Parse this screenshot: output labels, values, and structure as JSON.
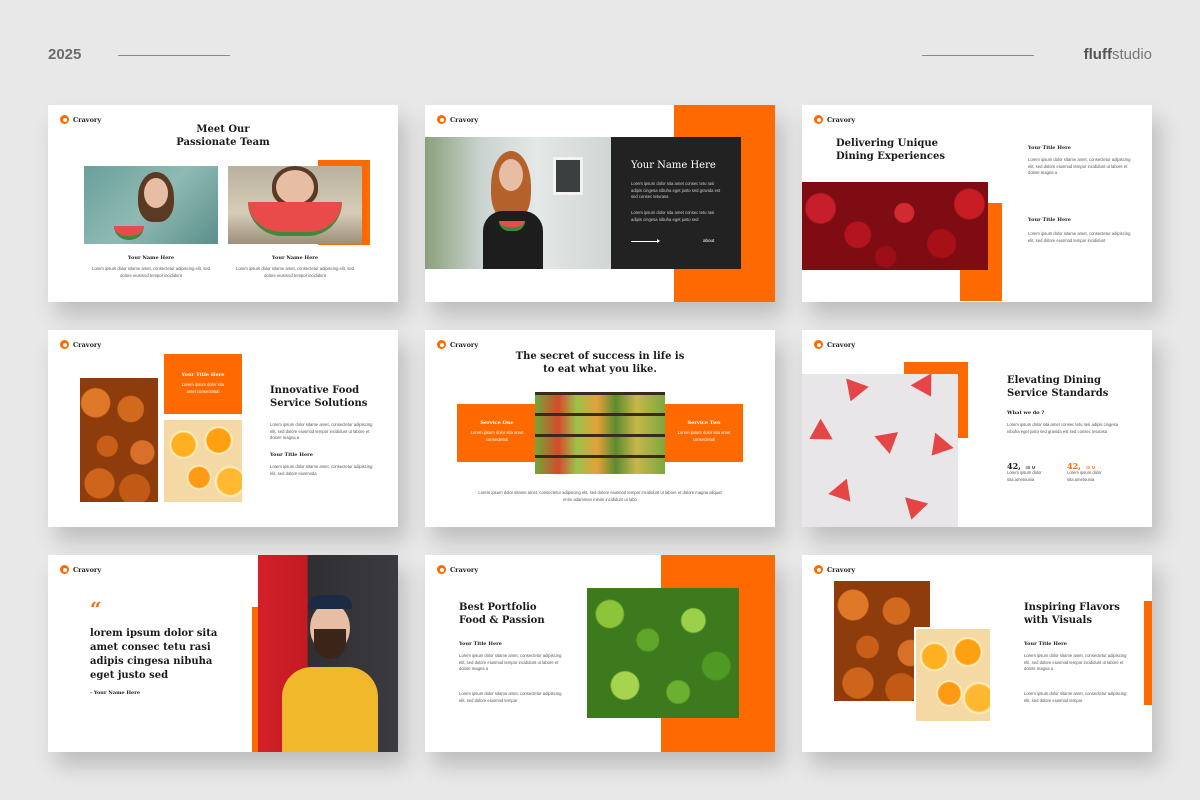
{
  "header": {
    "year": "2025",
    "brand_bold": "fluff",
    "brand_rest": "studio"
  },
  "logo_text": "Cravory",
  "colors": {
    "accent": "#ff6a00",
    "dark": "#222222",
    "background": "#e8e8e8"
  },
  "lorem_short": "Lorem ipsum dolor sitame amet, consectetur adipiscing elit, sed dolore eiusmod tempor incididunt",
  "s1": {
    "title_line1": "Meet Our",
    "title_line2": "Passionate Team",
    "card1_name": "Your Name Here",
    "card1_text": "Lorem ipsum dolor sitame amet, consectetur adipiscing elit, sed dolore eiusmod tempor incididunt",
    "card2_name": "Your Name Here",
    "card2_text": "Lorem ipsum dolor sitame amet, consectetur adipiscing elit, sed dolore eiusmod tempor incididunt"
  },
  "s2": {
    "title": "Your Name Here",
    "text1": "Lorem ipsum dolor sita amet consec tetu rasi adipis cingesa nibuha eget justo sed gravida est sed consec teturasa",
    "text2": "Lorem ipsum dolor sita amet consec tetu rasi adipis cingesa nibuha eget justo sed",
    "link": "about"
  },
  "s3": {
    "title_line1": "Delivering Unique",
    "title_line2": "Dining Experiences",
    "head1": "Your Title Here",
    "text1": "Lorem ipsum dolor sitame amet, consectetur adipiscing elit, sed dolore eiusmod tempor incididunt ut labore et dolore magna a",
    "head2": "Your Title Here",
    "text2": "Lorem ipsum dolor sitame amet, consectetur adipiscing elit, sed dolore eiusmod tempor incididunt"
  },
  "s4": {
    "box_head": "Your Title Here",
    "box_text": "Lorem ipsum dolor sita amet consectetuti",
    "title_line1": "Innovative Food",
    "title_line2": "Service Solutions",
    "text1": "Lorem ipsum dolor sitame amet, consectetur adipiscing elit, sed dolore eiusmod tempor incididunt ut labore et dolore magna a",
    "head2": "Your Title Here",
    "text2": "Lorem ipsum dolor sitame amet, consectetur adipiscing elit, sed dolore eiusmoda"
  },
  "s5": {
    "title_line1": "The secret of success in life is",
    "title_line2": "to eat what you like.",
    "left_head": "Service One",
    "left_text": "Lorem ipsum dolor sita amet consectetuti",
    "right_head": "Service Two",
    "right_text": "Lorem ipsum dolor sita amet consectetuti",
    "footer_text": "Lorem ipsum dolor sitame amet, consectetur adipiscing elit, sed dolore eiusmod tempor incididunt ut labore et dolore magna aliquat enim adamman minim incididunt ut labo"
  },
  "s6": {
    "title_line1": "Elevating Dining",
    "title_line2": "Service Standards",
    "subhead": "What we do ?",
    "text": "Lorem ipsum dolor sita amet consec tetu rasi adipis cingesa nibuha eget justo sed gravida est sed consec teturasa",
    "stat1_num": "42,",
    "stat1_unit": "45 M",
    "stat1_text": "Lorem ipsum dolor sita ametounia",
    "stat2_num": "42,",
    "stat2_unit": "45 M",
    "stat2_text": "Lorem ipsum dolor sita ametounia"
  },
  "s7": {
    "quote_mark": "“",
    "quote": "lorem ipsum dolor sita amet consec tetu rasi adipis cingesa nibuha eget justo sed",
    "author": "- Your Name Here"
  },
  "s8": {
    "title_line1": "Best Portfolio",
    "title_line2": "Food & Passion",
    "head": "Your Title Here",
    "text1": "Lorem ipsum dolor sitame amet, consectetur adipiscing elit, sed dolore eiusmod tempor incididunt ut labore et dolore magna a",
    "text2": "Lorem ipsum dolor sitame amet, consectetur adipiscing elit, sed dolore eiusmod tempor"
  },
  "s9": {
    "title_line1": "Inspiring Flavors",
    "title_line2": "with Visuals",
    "head": "Your Title Here",
    "text1": "Lorem ipsum dolor sitame amet, consectetur adipiscing elit, sed dolore eiusmod tempor incididunt ut labore et dolore magna a",
    "text2": "Lorem ipsum dolor sitame amet, consectetur adipiscing elit, sed dolore eiusmod tempor"
  }
}
